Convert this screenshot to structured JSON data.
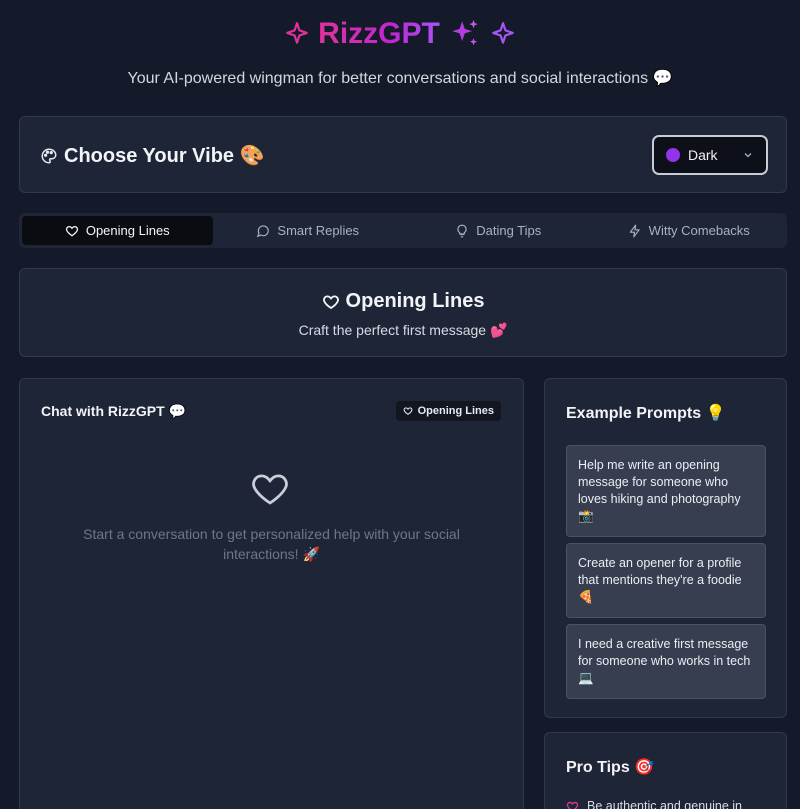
{
  "header": {
    "title": "RizzGPT",
    "subtitle": "Your AI-powered wingman for better conversations and social interactions 💬"
  },
  "vibe": {
    "title": "Choose Your Vibe 🎨",
    "selected_theme": "Dark",
    "theme_color": "#9333ea"
  },
  "tabs": [
    {
      "label": "Opening Lines",
      "icon": "heart-icon",
      "active": true
    },
    {
      "label": "Smart Replies",
      "icon": "message-circle-icon",
      "active": false
    },
    {
      "label": "Dating Tips",
      "icon": "lightbulb-icon",
      "active": false
    },
    {
      "label": "Witty Comebacks",
      "icon": "zap-icon",
      "active": false
    }
  ],
  "section": {
    "title": "Opening Lines",
    "subtitle": "Craft the perfect first message 💕"
  },
  "chat": {
    "title": "Chat with RizzGPT 💬",
    "badge": "Opening Lines",
    "empty_text": "Start a conversation to get personalized help with your social interactions! 🚀"
  },
  "examples": {
    "title": "Example Prompts 💡",
    "items": [
      "Help me write an opening message for someone who loves hiking and photography 📸",
      "Create an opener for a profile that mentions they're a foodie 🍕",
      "I need a creative first message for someone who works in tech 💻"
    ]
  },
  "tips": {
    "title": "Pro Tips 🎯",
    "first": "Be authentic and genuine in"
  },
  "colors": {
    "background": "#141a29",
    "card": "#1e2536",
    "accent_pink": "#e0339a",
    "accent_purple": "#a855f7"
  }
}
